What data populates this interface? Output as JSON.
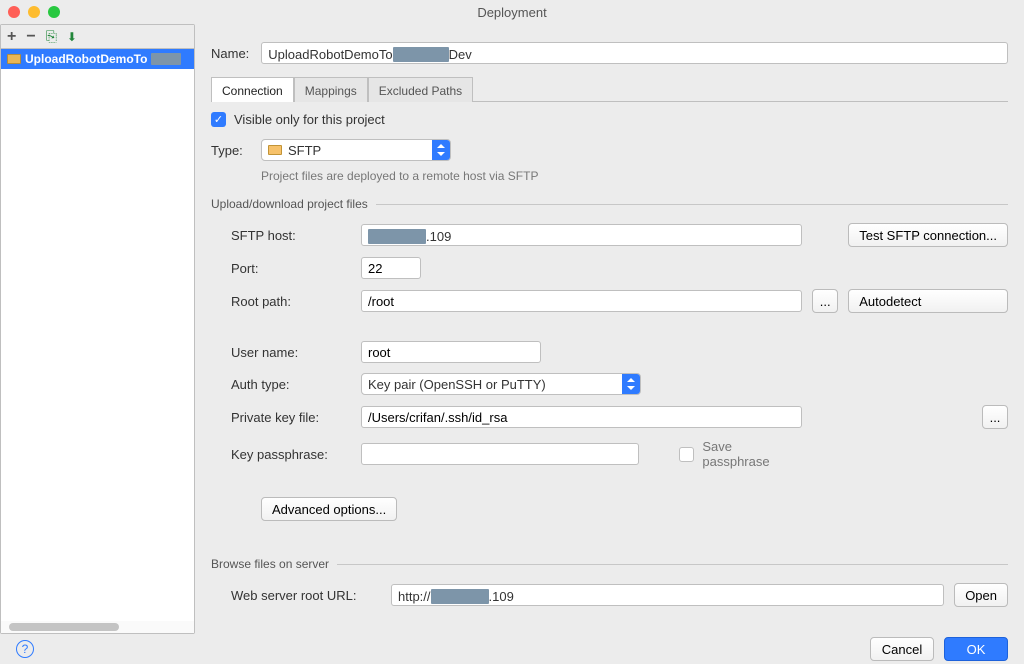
{
  "window": {
    "title": "Deployment"
  },
  "sidebar": {
    "item_label": "UploadRobotDemoTo"
  },
  "name": {
    "label": "Name:",
    "value_prefix": "UploadRobotDemoTo",
    "value_suffix": "Dev"
  },
  "tabs": {
    "connection": "Connection",
    "mappings": "Mappings",
    "excluded": "Excluded Paths"
  },
  "visible_label": "Visible only for this project",
  "type": {
    "label": "Type:",
    "value": "SFTP"
  },
  "type_help": "Project files are deployed to a remote host via SFTP",
  "legend_upload": "Upload/download project files",
  "fields": {
    "host_label": "SFTP host:",
    "host_suffix": ".109",
    "port_label": "Port:",
    "port": "22",
    "root_label": "Root path:",
    "root": "/root",
    "user_label": "User name:",
    "user": "root",
    "auth_label": "Auth type:",
    "auth": "Key pair (OpenSSH or PuTTY)",
    "pkey_label": "Private key file:",
    "pkey": "/Users/crifan/.ssh/id_rsa",
    "kpass_label": "Key passphrase:",
    "savepass": "Save passphrase"
  },
  "buttons": {
    "test": "Test SFTP connection...",
    "autodetect": "Autodetect",
    "advanced": "Advanced options...",
    "open": "Open",
    "cancel": "Cancel",
    "ok": "OK"
  },
  "legend_browse": "Browse files on server",
  "web": {
    "label": "Web server root URL:",
    "value_prefix": "http://",
    "value_suffix": ".109"
  }
}
